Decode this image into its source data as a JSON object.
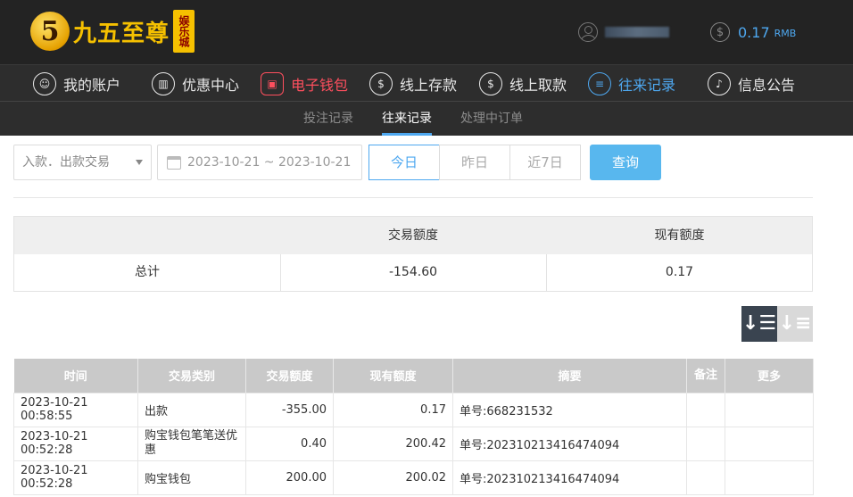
{
  "header": {
    "logo_digit": "5",
    "logo_text": "九五至尊",
    "logo_tag": "娱乐城",
    "user_icon": "user-icon",
    "balance_icon": "dollar-icon",
    "balance_value": "0.17",
    "balance_currency": "RMB"
  },
  "main_nav": [
    {
      "label": "我的账户",
      "icon": "user-circle-icon",
      "glyph": "☺"
    },
    {
      "label": "优惠中心",
      "icon": "gift-icon",
      "glyph": "▥"
    },
    {
      "label": "电子钱包",
      "icon": "wallet-icon",
      "glyph": "▣"
    },
    {
      "label": "线上存款",
      "icon": "deposit-icon",
      "glyph": "$"
    },
    {
      "label": "线上取款",
      "icon": "withdraw-icon",
      "glyph": "$"
    },
    {
      "label": "往来记录",
      "icon": "records-icon",
      "glyph": "≡"
    },
    {
      "label": "信息公告",
      "icon": "bell-icon",
      "glyph": "♪"
    }
  ],
  "sub_nav": [
    {
      "label": "投注记录"
    },
    {
      "label": "往来记录"
    },
    {
      "label": "处理中订单"
    }
  ],
  "filters": {
    "type_select": "入款．出款交易",
    "date_range": "2023-10-21 ~ 2023-10-21",
    "quick": [
      "今日",
      "昨日",
      "近7日"
    ],
    "query_label": "查询"
  },
  "summary": {
    "headers": [
      "交易额度",
      "现有额度"
    ],
    "row_label": "总计",
    "amount": "-154.60",
    "balance": "0.17"
  },
  "records": {
    "headers": [
      "时间",
      "交易类别",
      "交易额度",
      "现有额度",
      "摘要",
      "备注",
      "更多"
    ],
    "rows": [
      [
        "2023-10-21 00:58:55",
        "出款",
        "-355.00",
        "0.17",
        "单号:668231532",
        "",
        ""
      ],
      [
        "2023-10-21 00:52:28",
        "购宝钱包笔笔送优惠",
        "0.40",
        "200.42",
        "单号:202310213416474094",
        "",
        ""
      ],
      [
        "2023-10-21 00:52:28",
        "购宝钱包",
        "200.00",
        "200.02",
        "单号:202310213416474094",
        "",
        ""
      ]
    ]
  },
  "colors": {
    "accent_blue": "#4ea8f0",
    "accent_red": "#ff4f5e",
    "logo_gold": "#f5c000"
  }
}
